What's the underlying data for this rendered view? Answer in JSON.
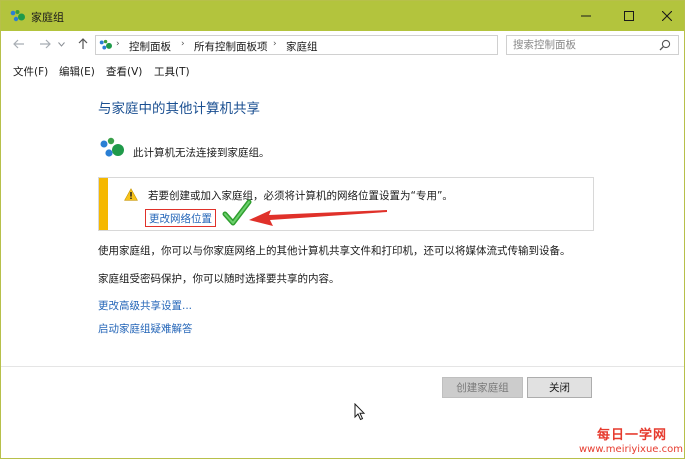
{
  "window": {
    "title": "家庭组",
    "titlebar_color": "#b3c43d"
  },
  "titlebar_controls": {
    "minimize": "—",
    "maximize": "☐",
    "close": "✕"
  },
  "nav": {
    "back_icon": "back-arrow-icon",
    "forward_icon": "forward-arrow-icon",
    "up_icon": "up-arrow-icon"
  },
  "address": {
    "breadcrumbs": [
      "控制面板",
      "所有控制面板项",
      "家庭组"
    ],
    "separator": "›"
  },
  "search": {
    "placeholder": "搜索控制面板"
  },
  "menu": {
    "items": [
      "文件(F)",
      "编辑(E)",
      "查看(V)",
      "工具(T)"
    ]
  },
  "content": {
    "heading": "与家庭中的其他计算机共享",
    "status_text": "此计算机无法连接到家庭组。",
    "warning": {
      "text": "若要创建或加入家庭组，必须将计算机的网络位置设置为“专用”。",
      "link": "更改网络位置",
      "stripe_color": "#f5b800"
    },
    "para1": "使用家庭组，你可以与你家庭网络上的其他计算机共享文件和打印机，还可以将媒体流式传输到设备。",
    "para2": "家庭组受密码保护，你可以随时选择要共享的内容。",
    "link_advanced": "更改高级共享设置...",
    "link_troubleshoot": "启动家庭组疑难解答"
  },
  "buttons": {
    "create": "创建家庭组",
    "close": "关闭"
  },
  "watermark": {
    "line1": "每日一学网",
    "line2": "www.meiriyixue.com"
  },
  "colors": {
    "link": "#2566b8",
    "heading": "#1a4f91",
    "annotation_red": "#e0312a",
    "annotation_green": "#3cb43c"
  }
}
